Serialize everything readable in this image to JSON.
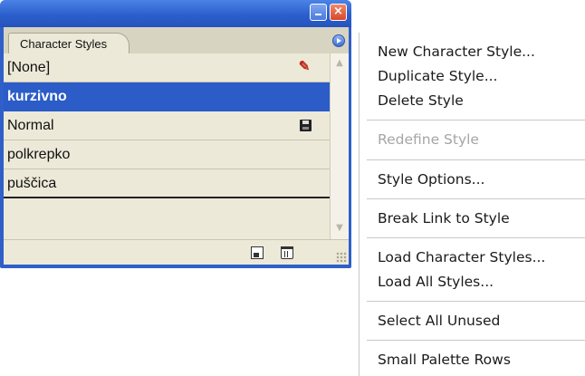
{
  "palette": {
    "tab_label": "Character Styles",
    "styles": [
      {
        "name": "[None]",
        "selected": false,
        "icon": "pencil-no-edit-icon"
      },
      {
        "name": "kurzivno",
        "selected": true,
        "icon": ""
      },
      {
        "name": "Normal",
        "selected": false,
        "icon": "disk-save-icon"
      },
      {
        "name": "polkrepko",
        "selected": false,
        "icon": ""
      },
      {
        "name": "puščica",
        "selected": false,
        "icon": ""
      }
    ],
    "colors": {
      "titlebar": "#2c5fcc",
      "selection": "#2b5cc8",
      "panel": "#ece9d8"
    }
  },
  "menu": {
    "items": [
      {
        "label": "New Character Style...",
        "enabled": true
      },
      {
        "label": "Duplicate Style...",
        "enabled": true
      },
      {
        "label": "Delete Style",
        "enabled": true
      },
      {
        "label": "Redefine Style",
        "enabled": false
      },
      {
        "label": "Style Options...",
        "enabled": true
      },
      {
        "label": "Break Link to Style",
        "enabled": true
      },
      {
        "label": "Load Character Styles...",
        "enabled": true
      },
      {
        "label": "Load All Styles...",
        "enabled": true
      },
      {
        "label": "Select All Unused",
        "enabled": true
      },
      {
        "label": "Small Palette Rows",
        "enabled": true
      }
    ]
  }
}
